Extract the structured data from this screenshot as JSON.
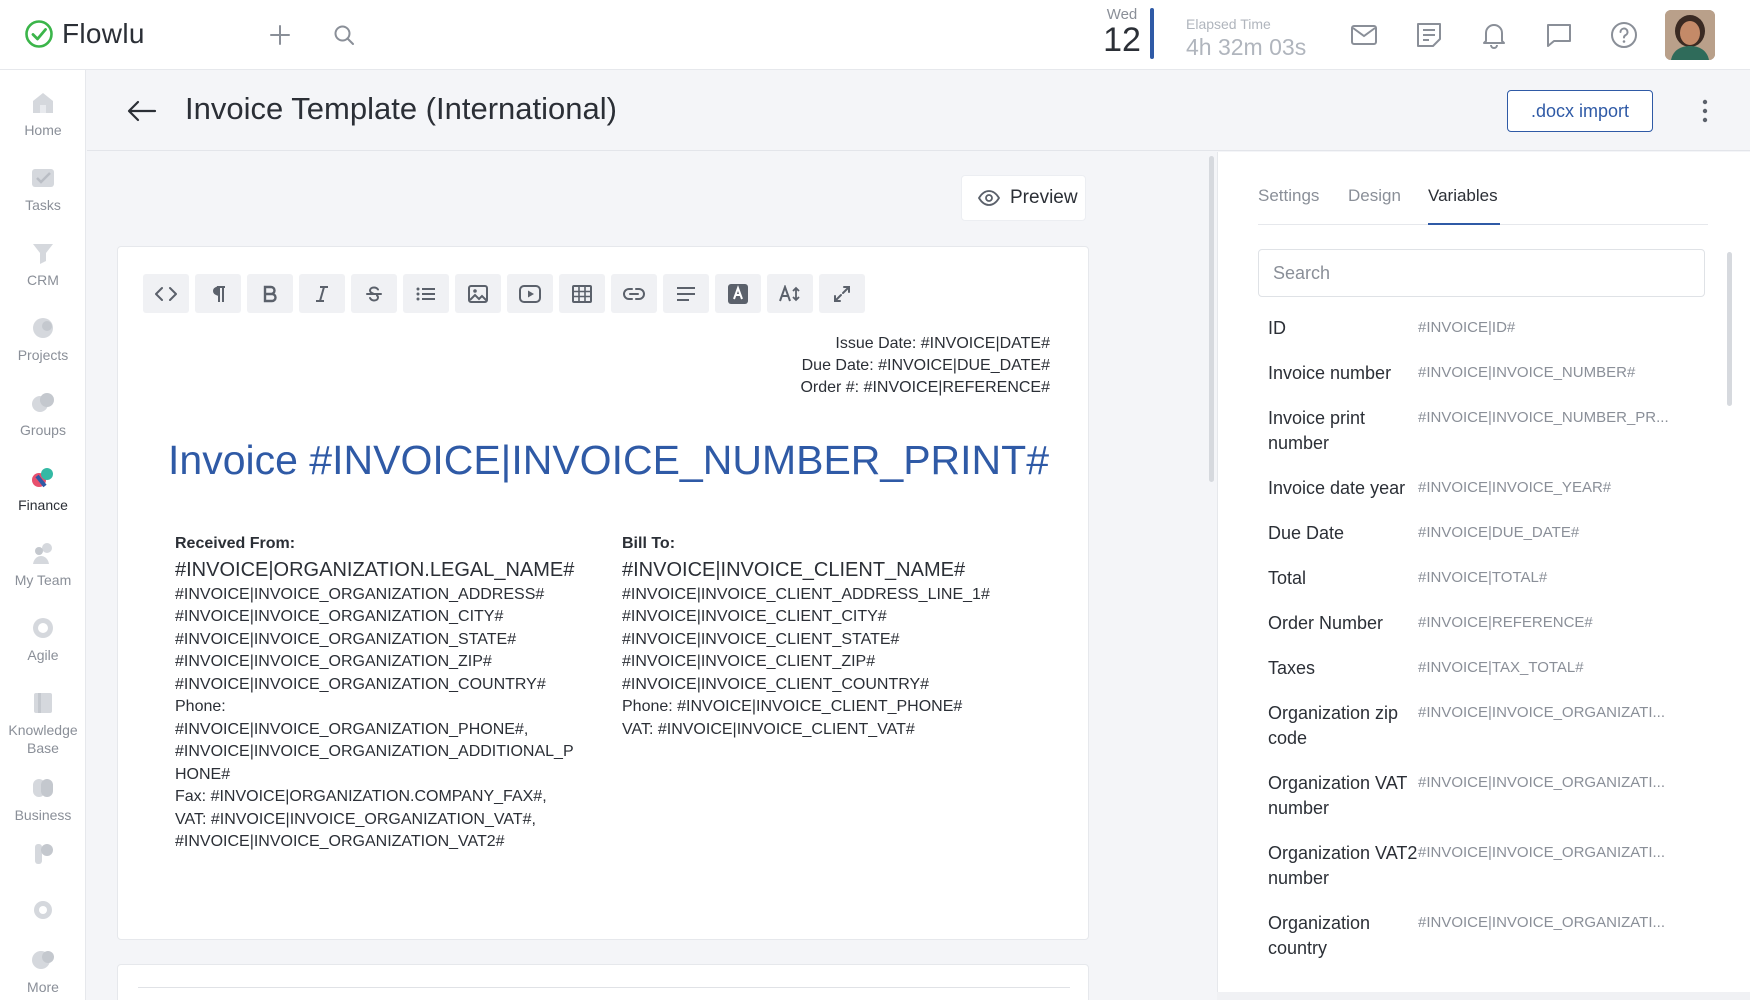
{
  "app": {
    "name": "Flowlu",
    "brand_color": "#2f5aa6",
    "logo_color": "#3bb54a"
  },
  "topbar": {
    "date_day": "Wed",
    "date_num": "12",
    "elapsed_label": "Elapsed Time",
    "elapsed_value": "4h 32m 03s"
  },
  "sidebar": {
    "items": [
      {
        "label": "Home",
        "icon": "home-icon"
      },
      {
        "label": "Tasks",
        "icon": "tasks-icon"
      },
      {
        "label": "CRM",
        "icon": "crm-icon"
      },
      {
        "label": "Projects",
        "icon": "projects-icon"
      },
      {
        "label": "Groups",
        "icon": "groups-icon"
      },
      {
        "label": "Finance",
        "icon": "finance-icon",
        "active": true
      },
      {
        "label": "My Team",
        "icon": "team-icon"
      },
      {
        "label": "Agile",
        "icon": "agile-icon"
      },
      {
        "label": "Knowledge Base",
        "icon": "knowledge-base-icon"
      },
      {
        "label": "Business",
        "icon": "business-icon"
      },
      {
        "label": "",
        "icon": "integrations-icon"
      },
      {
        "label": "",
        "icon": "settings-icon"
      },
      {
        "label": "More",
        "icon": "more-icon"
      }
    ]
  },
  "header": {
    "title": "Invoice Template (International)",
    "docx_import": ".docx import"
  },
  "editor": {
    "preview_label": "Preview",
    "dates": {
      "issue": "Issue Date: #INVOICE|DATE#",
      "due": "Due Date: #INVOICE|DUE_DATE#",
      "order": "Order #: #INVOICE|REFERENCE#"
    },
    "invoice_title": "Invoice #INVOICE|INVOICE_NUMBER_PRINT#",
    "received_from": {
      "heading": "Received From:",
      "name": "#INVOICE|ORGANIZATION.LEGAL_NAME#",
      "address": "#INVOICE|INVOICE_ORGANIZATION_ADDRESS#",
      "city": "#INVOICE|INVOICE_ORGANIZATION_CITY#",
      "state": "#INVOICE|INVOICE_ORGANIZATION_STATE#",
      "zip": "#INVOICE|INVOICE_ORGANIZATION_ZIP#",
      "country": "#INVOICE|INVOICE_ORGANIZATION_COUNTRY#",
      "phone_label": "Phone:",
      "phone": "#INVOICE|INVOICE_ORGANIZATION_PHONE#,",
      "additional_phone": "#INVOICE|INVOICE_ORGANIZATION_ADDITIONAL_PHONE#",
      "fax": "Fax: #INVOICE|ORGANIZATION.COMPANY_FAX#,",
      "vat": "VAT: #INVOICE|INVOICE_ORGANIZATION_VAT#,",
      "vat2": "#INVOICE|INVOICE_ORGANIZATION_VAT2#"
    },
    "bill_to": {
      "heading": "Bill To:",
      "name": "#INVOICE|INVOICE_CLIENT_NAME#",
      "address": "#INVOICE|INVOICE_CLIENT_ADDRESS_LINE_1#",
      "city": "#INVOICE|INVOICE_CLIENT_CITY#",
      "state": "#INVOICE|INVOICE_CLIENT_STATE#",
      "zip": "#INVOICE|INVOICE_CLIENT_ZIP#",
      "country": "#INVOICE|INVOICE_CLIENT_COUNTRY#",
      "phone": "Phone: #INVOICE|INVOICE_CLIENT_PHONE#",
      "vat": "VAT: #INVOICE|INVOICE_CLIENT_VAT#"
    }
  },
  "panel": {
    "tabs": [
      "Settings",
      "Design",
      "Variables"
    ],
    "active_tab": "Variables",
    "search_placeholder": "Search",
    "variables": [
      {
        "label": "ID",
        "value": "#INVOICE|ID#"
      },
      {
        "label": "Invoice number",
        "value": "#INVOICE|INVOICE_NUMBER#"
      },
      {
        "label": "Invoice print number",
        "value": "#INVOICE|INVOICE_NUMBER_PR..."
      },
      {
        "label": "Invoice date year",
        "value": "#INVOICE|INVOICE_YEAR#"
      },
      {
        "label": "Due Date",
        "value": "#INVOICE|DUE_DATE#"
      },
      {
        "label": "Total",
        "value": "#INVOICE|TOTAL#"
      },
      {
        "label": "Order Number",
        "value": "#INVOICE|REFERENCE#"
      },
      {
        "label": "Taxes",
        "value": "#INVOICE|TAX_TOTAL#"
      },
      {
        "label": "Organization zip code",
        "value": "#INVOICE|INVOICE_ORGANIZATI..."
      },
      {
        "label": "Organization VAT number",
        "value": "#INVOICE|INVOICE_ORGANIZATI..."
      },
      {
        "label": "Organization VAT2 number",
        "value": "#INVOICE|INVOICE_ORGANIZATI..."
      },
      {
        "label": "Organization country",
        "value": "#INVOICE|INVOICE_ORGANIZATI..."
      }
    ]
  }
}
